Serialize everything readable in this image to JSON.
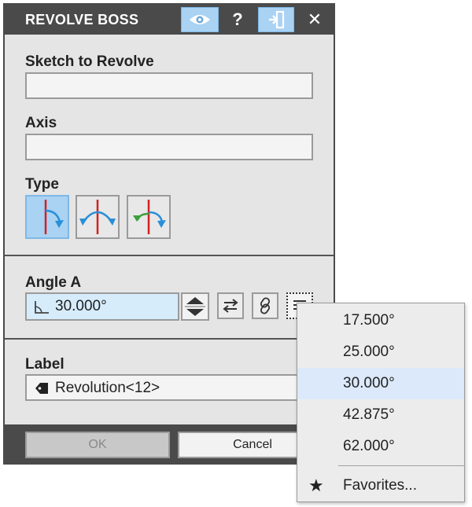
{
  "panel": {
    "title": "REVOLVE BOSS",
    "titlebar_icons": [
      "eye-icon",
      "help-icon",
      "pin-icon",
      "close-icon"
    ],
    "help_glyph": "?",
    "close_glyph": "✕"
  },
  "sections": {
    "sketch_label": "Sketch to Revolve",
    "axis_label": "Axis",
    "type_label": "Type",
    "angle_label": "Angle A",
    "label_label": "Label"
  },
  "sketch_value": "",
  "axis_value": "",
  "type_options": [
    "one-direction",
    "mid-plane",
    "two-directions"
  ],
  "type_selected": "one-direction",
  "angle": {
    "value": "30.000°",
    "dropdown": [
      "17.500°",
      "25.000°",
      "30.000°",
      "42.875°",
      "62.000°"
    ],
    "selected_index": 2,
    "favorites_label": "Favorites..."
  },
  "label_value": "Revolution<12>",
  "footer": {
    "ok_label": "OK",
    "cancel_label": "Cancel"
  },
  "colors": {
    "titlebar": "#4a4a4a",
    "panel": "#e5e5e5",
    "active_button": "#a9d2f3",
    "angle_field": "#d6ecfb",
    "dropdown_selected": "#dbe9fa",
    "axis_red": "#d42020",
    "arrow_blue": "#2a8fd8",
    "arrow_green": "#3ca13c"
  }
}
